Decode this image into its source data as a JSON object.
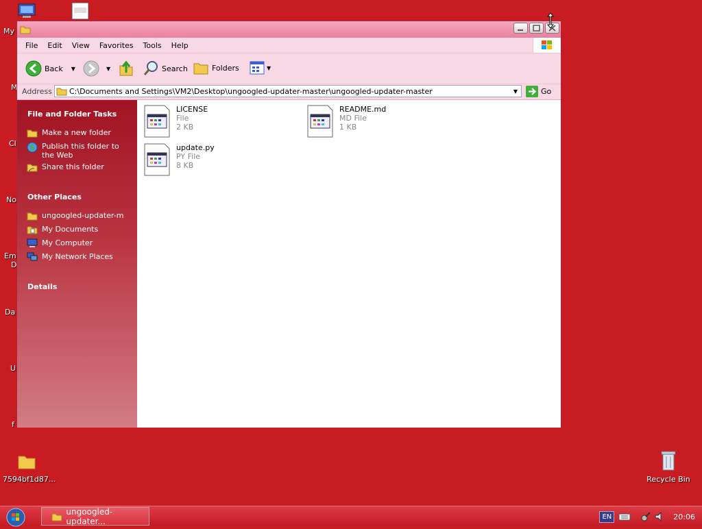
{
  "desktop": {
    "left_labels": [
      "My",
      "M",
      "Cl",
      "No",
      "Em",
      "D",
      "Da",
      "U",
      "f"
    ],
    "folder_icon_label": "7594bf1d87...",
    "recycle_bin_label": "Recycle Bin"
  },
  "window": {
    "menu": [
      "File",
      "Edit",
      "View",
      "Favorites",
      "Tools",
      "Help"
    ],
    "toolbar": {
      "back": "Back",
      "search": "Search",
      "folders": "Folders"
    },
    "address": {
      "label": "Address",
      "value": "C:\\Documents and Settings\\VM2\\Desktop\\ungoogled-updater-master\\ungoogled-updater-master",
      "go": "Go"
    },
    "left_pane": {
      "tasks_title": "File and Folder Tasks",
      "tasks": [
        "Make a new folder",
        "Publish this folder to the Web",
        "Share this folder"
      ],
      "places_title": "Other Places",
      "places": [
        "ungoogled-updater-m",
        "My Documents",
        "My Computer",
        "My Network Places"
      ],
      "details_title": "Details"
    },
    "files": [
      {
        "name": "LICENSE",
        "type": "File",
        "size": "2 KB"
      },
      {
        "name": "README.md",
        "type": "MD File",
        "size": "1 KB"
      },
      {
        "name": "update.py",
        "type": "PY File",
        "size": "8 KB"
      }
    ]
  },
  "taskbar": {
    "task_label": "ungoogled-updater...",
    "lang": "EN",
    "time": "20:06"
  }
}
